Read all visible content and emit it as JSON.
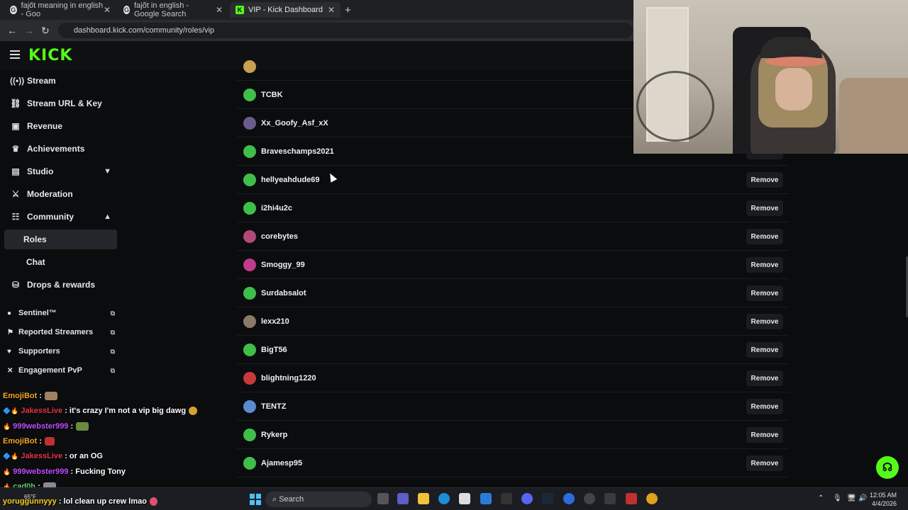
{
  "browser": {
    "tabs": [
      {
        "title": "fajőt meaning in english - Goo",
        "active": false
      },
      {
        "title": "fajõt in english - Google Search",
        "active": false
      },
      {
        "title": "VIP - Kick Dashboard",
        "active": true
      }
    ],
    "url": "dashboard.kick.com/community/roles/vip"
  },
  "app": {
    "logo": "KICK",
    "accent": "#53fc18"
  },
  "sidebar": {
    "items": [
      {
        "label": "Stream",
        "icon": "broadcast-icon"
      },
      {
        "label": "Stream URL & Key",
        "icon": "link-icon"
      },
      {
        "label": "Revenue",
        "icon": "revenue-icon"
      },
      {
        "label": "Achievements",
        "icon": "trophy-icon"
      },
      {
        "label": "Studio",
        "icon": "studio-icon"
      },
      {
        "label": "Moderation",
        "icon": "sword-icon"
      },
      {
        "label": "Community",
        "icon": "community-icon"
      },
      {
        "label": "Roles",
        "icon": ""
      },
      {
        "label": "Chat",
        "icon": ""
      },
      {
        "label": "Drops & rewards",
        "icon": "drops-icon"
      }
    ],
    "external": [
      {
        "label": "Sentinel™"
      },
      {
        "label": "Reported Streamers"
      },
      {
        "label": "Supporters"
      },
      {
        "label": "Engagement PvP"
      }
    ]
  },
  "chat": [
    {
      "user": "EmojiBot",
      "msg": "",
      "color": "#f5a623",
      "emote": "#a08060"
    },
    {
      "user": "JakessLive",
      "msg": "it's crazy I'm not a vip big dawg",
      "color": "#e8334a",
      "emote": "#d9a030"
    },
    {
      "user": "999webster999",
      "msg": "",
      "color": "#c04cff",
      "emote": "#6a8a40"
    },
    {
      "user": "EmojiBot",
      "msg": "",
      "color": "#f5a623",
      "emote": "#c03030"
    },
    {
      "user": "JakessLive",
      "msg": "or an OG",
      "color": "#e8334a",
      "emote": ""
    },
    {
      "user": "999webster999",
      "msg": "Fucking Tony",
      "color": "#c04cff",
      "emote": ""
    },
    {
      "user": "cad0h",
      "msg": "",
      "color": "#5ad36a",
      "emote": "#8a8a90"
    },
    {
      "user": "yoruggunnyyy",
      "msg": "lol clean up crew lmao",
      "color": "#f5d020",
      "emote": "#e05070"
    }
  ],
  "vip_list": {
    "remove_label": "Remove",
    "rows": [
      {
        "name": "TCBK",
        "avatar": "#3fbf4a"
      },
      {
        "name": "Xx_Goofy_Asf_xX",
        "avatar": "#6a5c8a"
      },
      {
        "name": "Braveschamps2021",
        "avatar": "#3fbf4a"
      },
      {
        "name": "hellyeahdude69",
        "avatar": "#3fbf4a"
      },
      {
        "name": "i2hi4u2c",
        "avatar": "#3fbf4a"
      },
      {
        "name": "corebytes",
        "avatar": "#b04a7a"
      },
      {
        "name": "Smoggy_99",
        "avatar": "#c43a8a"
      },
      {
        "name": "Surdabsalot",
        "avatar": "#3fbf4a"
      },
      {
        "name": "lexx210",
        "avatar": "#8a7a6a"
      },
      {
        "name": "BigT56",
        "avatar": "#3fbf4a"
      },
      {
        "name": "blightning1220",
        "avatar": "#c83a3a"
      },
      {
        "name": "TENTZ",
        "avatar": "#5a8acf"
      },
      {
        "name": "Rykerp",
        "avatar": "#3fbf4a"
      },
      {
        "name": "Ajamesp95",
        "avatar": "#3fbf4a"
      }
    ]
  },
  "taskbar": {
    "search_label": "Search",
    "weather": "65°F",
    "time": "12:05 AM",
    "date": "4/4/2026"
  }
}
